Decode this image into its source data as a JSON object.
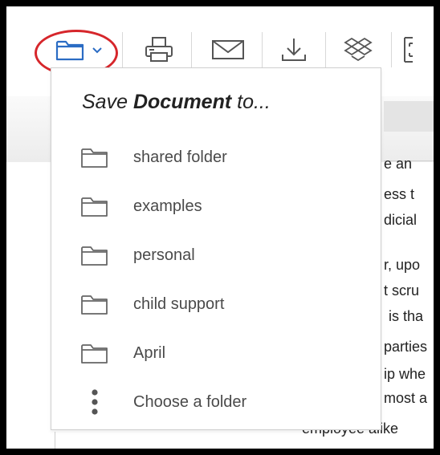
{
  "toolbar": {
    "buttons": [
      {
        "name": "save-to-folder",
        "icon": "folder-icon"
      },
      {
        "name": "print",
        "icon": "printer-icon"
      },
      {
        "name": "email",
        "icon": "envelope-icon"
      },
      {
        "name": "download",
        "icon": "download-icon"
      },
      {
        "name": "dropbox",
        "icon": "dropbox-icon"
      },
      {
        "name": "fullscreen",
        "icon": "expand-icon"
      }
    ],
    "highlight_color": "#d6262b",
    "icon_color_active": "#2b6cc4",
    "icon_color": "#555555"
  },
  "menu": {
    "title_prefix": "Save ",
    "title_bold": "Document",
    "title_suffix": " to...",
    "items": [
      {
        "label": "shared folder",
        "icon": "folder-icon"
      },
      {
        "label": "examples",
        "icon": "folder-icon"
      },
      {
        "label": "personal",
        "icon": "folder-icon"
      },
      {
        "label": "child support",
        "icon": "folder-icon"
      },
      {
        "label": "April",
        "icon": "folder-icon"
      },
      {
        "label": "Choose a folder",
        "icon": "more-vertical-icon"
      }
    ]
  },
  "document": {
    "fragments": [
      "e an",
      "ess t",
      "dicial",
      "r, upo",
      "t scru",
      "is tha",
      "parties",
      "ip whe",
      "most a",
      "employee alike"
    ]
  }
}
